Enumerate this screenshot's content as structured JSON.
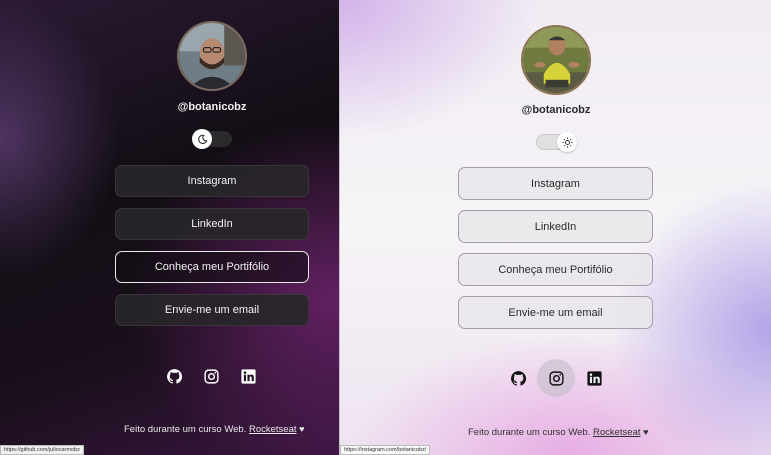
{
  "dark": {
    "handle": "@botanicobz",
    "theme_toggle": {
      "state": "dark"
    },
    "buttons": [
      {
        "label": "Instagram"
      },
      {
        "label": "LinkedIn"
      },
      {
        "label": "Conheça meu Portifólio"
      },
      {
        "label": "Envie-me um email"
      }
    ],
    "social": [
      "github-icon",
      "instagram-icon",
      "linkedin-icon"
    ],
    "footer": {
      "text": "Feito durante um curso Web.",
      "link": "Rocketseat",
      "heart": "♥"
    },
    "status_url": "https://github.com/juliocarmobz"
  },
  "light": {
    "handle": "@botanicobz",
    "theme_toggle": {
      "state": "light"
    },
    "buttons": [
      {
        "label": "Instagram"
      },
      {
        "label": "LinkedIn"
      },
      {
        "label": "Conheça meu Portifólio"
      },
      {
        "label": "Envie-me um email"
      }
    ],
    "social": [
      "github-icon",
      "instagram-icon",
      "linkedin-icon"
    ],
    "footer": {
      "text": "Feito durante um curso Web.",
      "link": "Rocketseat",
      "heart": "♥"
    },
    "status_url": "https://instagram.com/botanicobz/"
  },
  "colors": {
    "dark_accent": "#6e236e",
    "light_accent": "#c8a0e6"
  }
}
